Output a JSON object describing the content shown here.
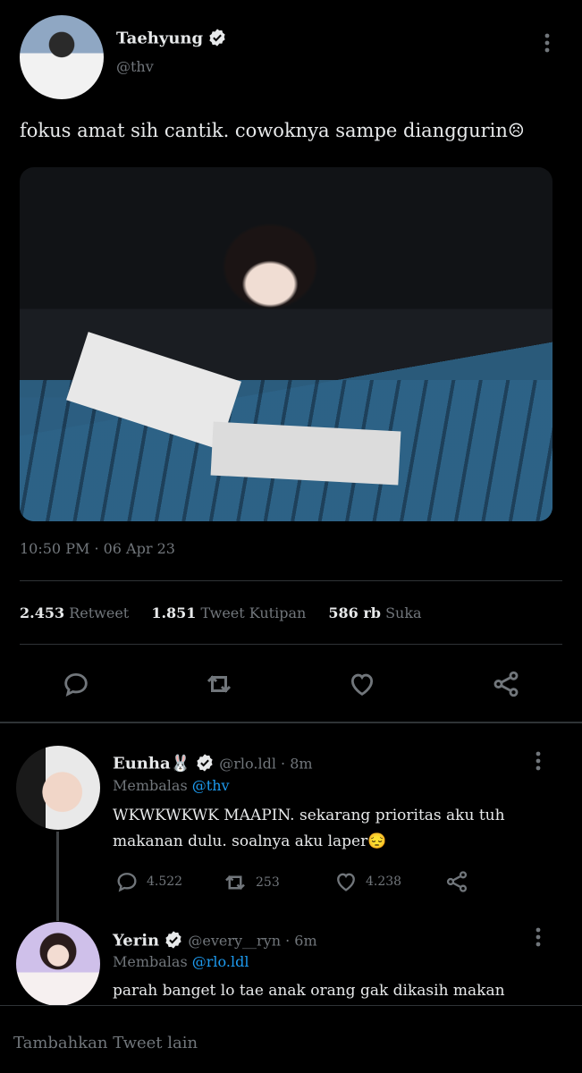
{
  "tweet": {
    "author_name": "Taehyung",
    "author_handle": "@thv",
    "text": "fokus amat sih cantik. cowoknya sampe dianggurin☹",
    "time": "10:50 PM",
    "date": "06 Apr 23",
    "stats": {
      "retweets": "2.453",
      "retweets_label": "Retweet",
      "quotes": "1.851",
      "quotes_label": "Tweet Kutipan",
      "likes": "586 rb",
      "likes_label": "Suka"
    }
  },
  "replies": [
    {
      "name": "Eunha",
      "emoji": "🐰",
      "handle": "@rlo.ldl",
      "time": "8m",
      "replying_label": "Membalas",
      "replying_to": "@thv",
      "text_line1": "WKWKWKWK MAAPIN. sekarang prioritas aku tuh",
      "text_line2": "makanan dulu. soalnya aku laper😔",
      "reply_count": "4.522",
      "retweet_count": "253",
      "like_count": "4.238"
    },
    {
      "name": "Yerin",
      "handle": "@every__ryn",
      "time": "6m",
      "replying_label": "Membalas",
      "replying_to": "@rlo.ldl",
      "text": "parah banget lo tae anak orang gak dikasih makan"
    }
  ],
  "footer": {
    "add_tweet": "Tambahkan Tweet lain"
  },
  "colors": {
    "background": "#000000",
    "text": "#e7e9ea",
    "muted": "#71767b",
    "link": "#1d9bf0",
    "divider": "#2f3336"
  },
  "icons": [
    "verified-badge-icon",
    "more-vertical-icon",
    "reply-icon",
    "retweet-icon",
    "like-icon",
    "share-icon"
  ]
}
